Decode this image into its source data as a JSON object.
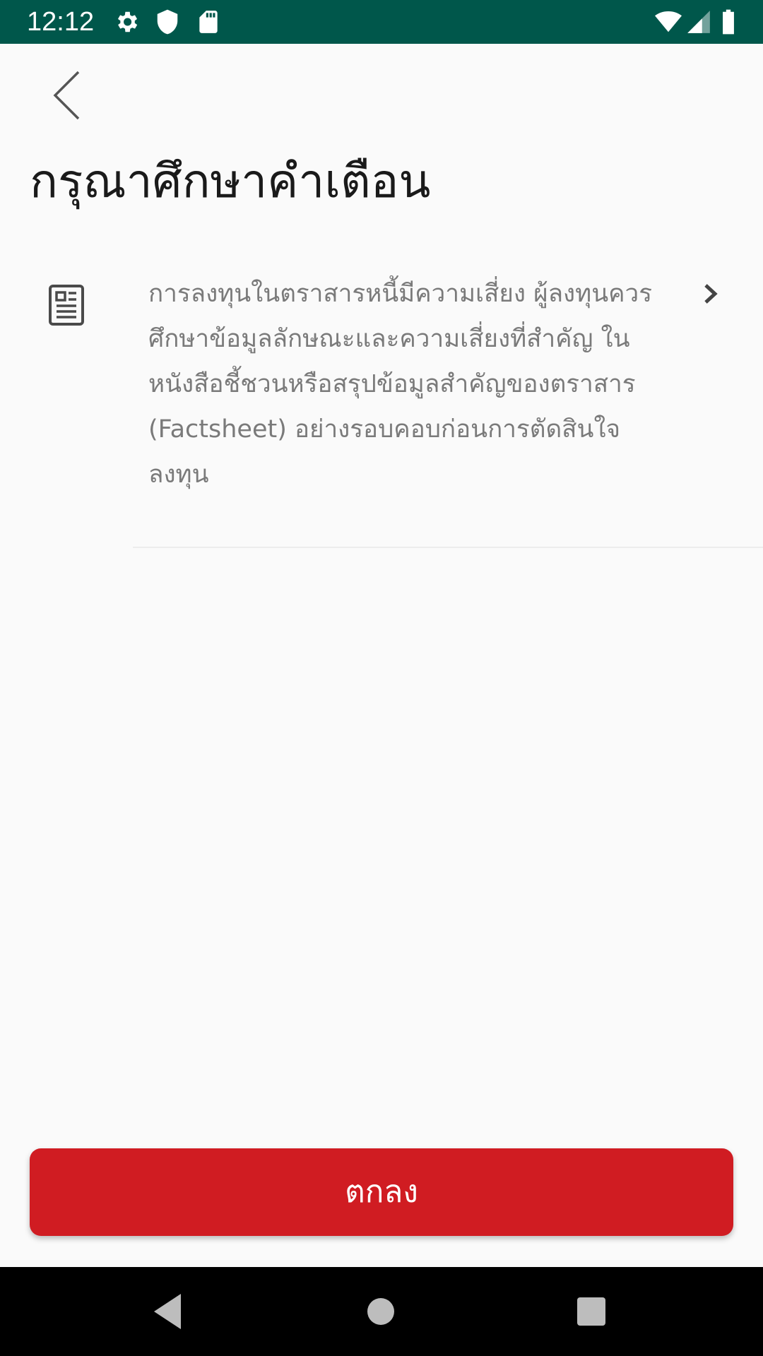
{
  "status_bar": {
    "time": "12:12",
    "background": "#00574b",
    "left_icons": [
      "gear-icon",
      "shield-icon",
      "sd-card-icon"
    ],
    "right_icons": [
      "wifi-icon",
      "cellular-signal-icon",
      "battery-icon"
    ]
  },
  "header": {
    "back_icon": "chevron-left-icon",
    "title": "กรุณาศึกษาคำเตือน"
  },
  "warning": {
    "icon": "document-icon",
    "text": "การลงทุนในตราสารหนี้มีความเสี่ยง ผู้ลงทุนควรศึกษาข้อมูลลักษณะและความเสี่ยงที่สำคัญ ในหนังสือชี้ชวนหรือสรุปข้อมูลสำคัญของตราสาร (Factsheet) อย่างรอบคอบก่อนการตัดสินใจลงทุน",
    "chevron_icon": "chevron-right-icon"
  },
  "footer": {
    "confirm_label": "ตกลง",
    "confirm_color": "#d01c22"
  },
  "nav_bar": {
    "buttons": [
      "back-triangle-icon",
      "home-circle-icon",
      "recents-square-icon"
    ]
  }
}
